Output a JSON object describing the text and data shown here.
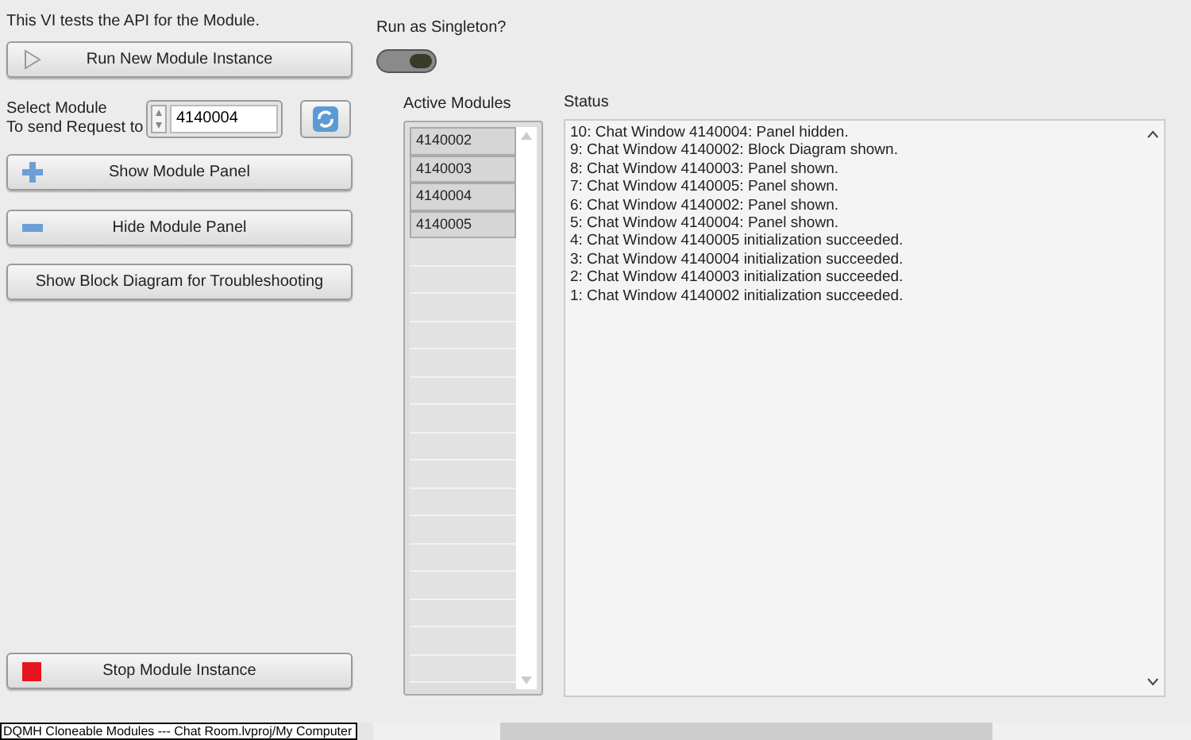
{
  "description": "This VI tests the API for the Module.",
  "run_button": {
    "label": "Run New Module Instance"
  },
  "select_module": {
    "label": "Select Module\nTo send Request to",
    "value": "4140004"
  },
  "show_button": {
    "label": "Show Module Panel"
  },
  "hide_button": {
    "label": "Hide Module Panel"
  },
  "block_diagram_button": {
    "label": "Show Block Diagram for Troubleshooting"
  },
  "stop_button": {
    "label": "Stop Module Instance"
  },
  "singleton": {
    "label": "Run as Singleton?",
    "on": false
  },
  "active_modules": {
    "label": "Active Modules",
    "items": [
      "4140002",
      "4140003",
      "4140004",
      "4140005"
    ]
  },
  "status": {
    "label": "Status",
    "lines": [
      "10: Chat Window 4140004: Panel hidden.",
      "9: Chat Window 4140002: Block Diagram shown.",
      "8: Chat Window 4140003: Panel shown.",
      "7: Chat Window 4140005: Panel shown.",
      "6: Chat Window 4140002: Panel shown.",
      "5: Chat Window 4140004: Panel shown.",
      "4: Chat Window 4140005 initialization succeeded.",
      "3: Chat Window 4140004 initialization succeeded.",
      "2: Chat Window 4140003 initialization succeeded.",
      "1: Chat Window 4140002 initialization succeeded."
    ]
  },
  "taskbar": {
    "title": "DQMH Cloneable Modules --- Chat Room.lvproj/My Computer"
  }
}
